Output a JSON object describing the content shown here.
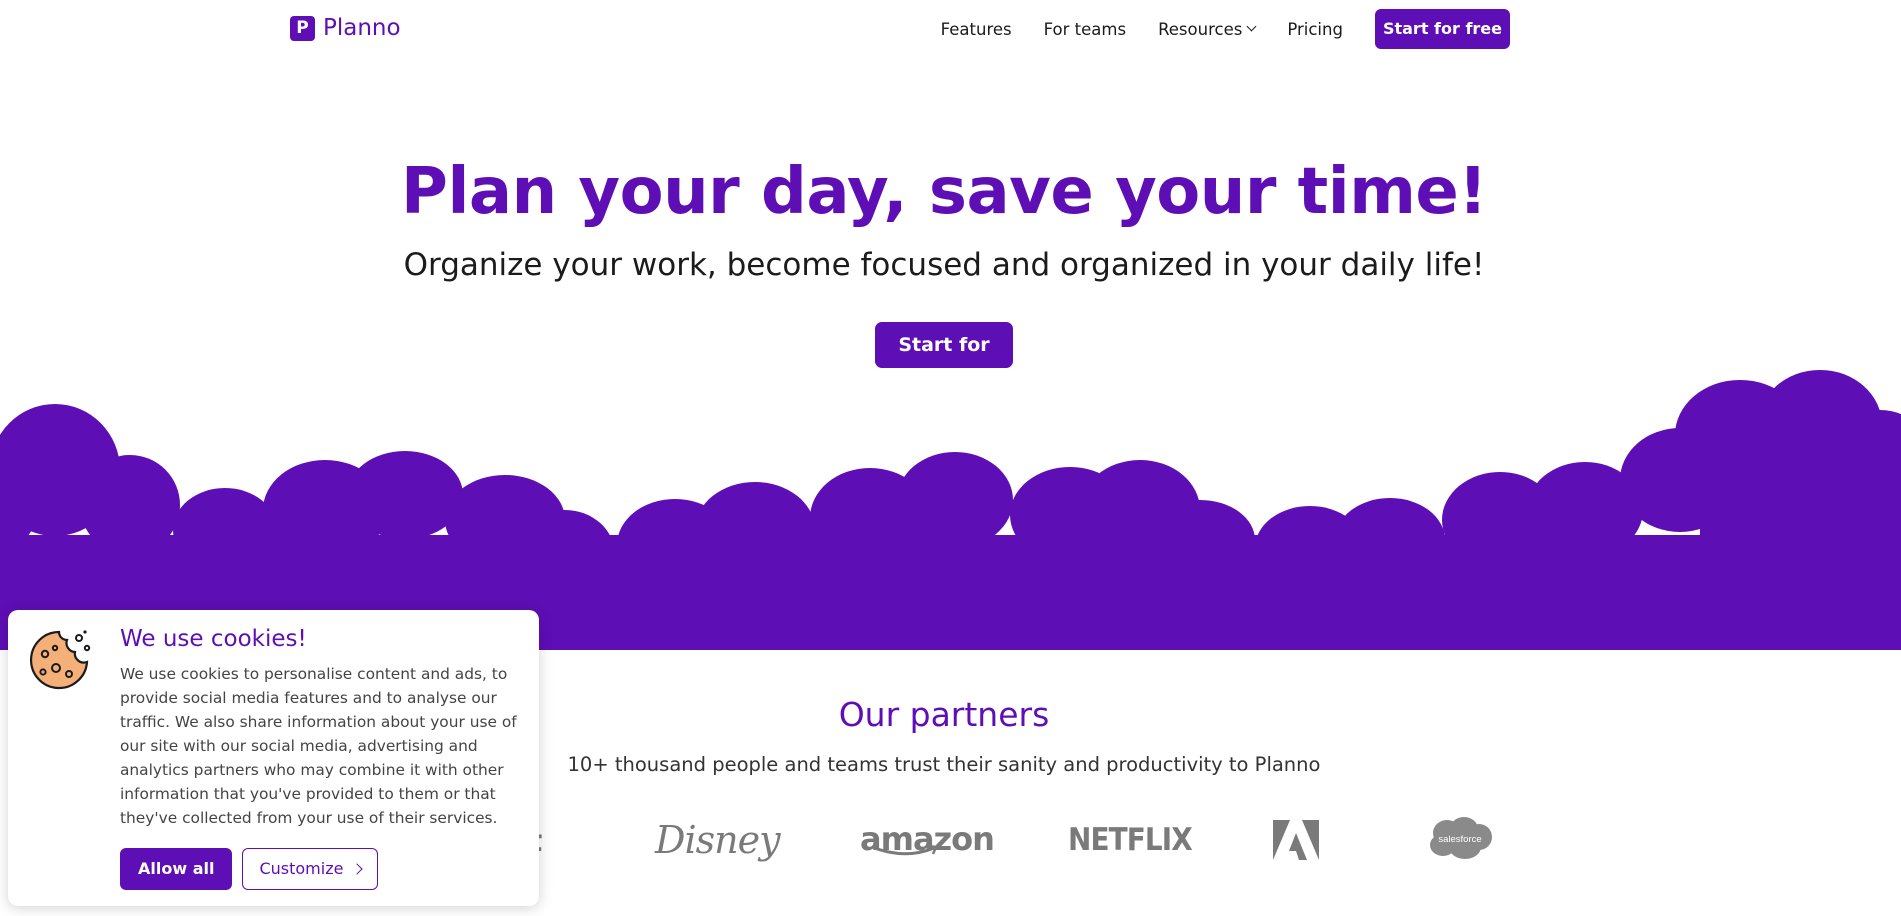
{
  "brand": {
    "logo_letter": "P",
    "name": "Planno",
    "color": "#5e0eb5"
  },
  "nav": {
    "features": "Features",
    "teams": "For teams",
    "resources": "Resources",
    "pricing": "Pricing",
    "cta": "Start for free"
  },
  "hero": {
    "title": "Plan your day, save your time!",
    "subtitle": "Organize your work, become focused and organized in your daily life!",
    "cta": "Start for free"
  },
  "partners": {
    "title": "Our partners",
    "subtitle": "10+ thousand people and teams trust their sanity and productivity to Planno",
    "logos": {
      "partial": "t",
      "disney": "Disney",
      "amazon": "amazon",
      "netflix": "NETFLIX",
      "adobe": "adobe-logo",
      "salesforce": "salesforce"
    }
  },
  "cookie": {
    "title": "We use cookies!",
    "body": "We use cookies to personalise content and ads, to provide social media features and to analyse our traffic. We also share information about your use of our site with our social media, advertising and analytics partners who may combine it with other information that you've provided to them or that they've collected from your use of their services.",
    "allow": "Allow all",
    "customize": "Customize"
  }
}
